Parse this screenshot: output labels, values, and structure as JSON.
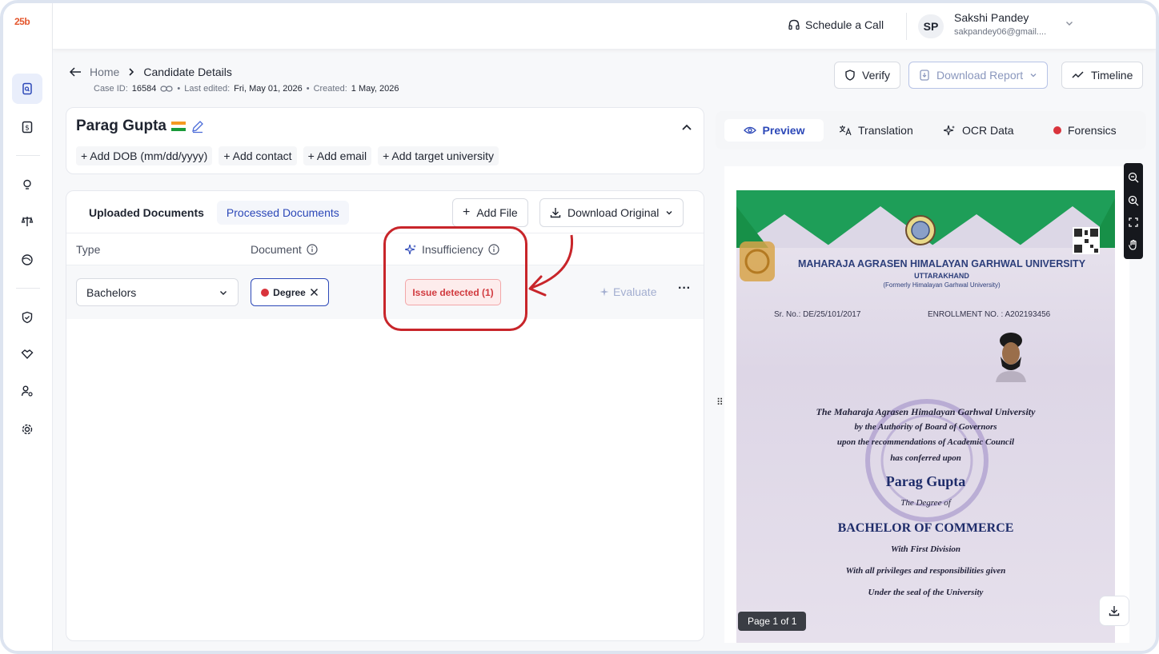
{
  "app": {
    "logo_text": "25b"
  },
  "topbar": {
    "schedule_label": "Schedule a Call",
    "user": {
      "initials": "SP",
      "name": "Sakshi Pandey",
      "email": "sakpandey06@gmail...."
    }
  },
  "breadcrumb": {
    "home": "Home",
    "current": "Candidate Details"
  },
  "meta": {
    "case_label": "Case ID:",
    "case_id": "16584",
    "edited_label": "Last edited:",
    "edited": "Fri, May 01, 2026",
    "created_label": "Created:",
    "created": "1 May, 2026",
    "separator": "•"
  },
  "actions": {
    "verify": "Verify",
    "download_report": "Download Report",
    "timeline": "Timeline"
  },
  "candidate": {
    "name": "Parag Gupta",
    "add_links": [
      "+ Add DOB (mm/dd/yyyy)",
      "+ Add contact",
      "+ Add email",
      "+ Add target university"
    ]
  },
  "documents": {
    "tabs": [
      "Uploaded Documents",
      "Processed Documents"
    ],
    "add_file": "Add File",
    "download_original": "Download Original",
    "columns": [
      "Type",
      "Document",
      "Insufficiency"
    ],
    "row": {
      "type": "Bachelors",
      "document": "Degree",
      "issue": "Issue detected (1)",
      "evaluate": "Evaluate",
      "more": "···"
    }
  },
  "preview": {
    "tabs": [
      "Preview",
      "Translation",
      "OCR Data",
      "Forensics"
    ],
    "page_indicator": "Page 1 of 1"
  },
  "certificate": {
    "university": "MAHARAJA AGRASEN HIMALAYAN GARHWAL UNIVERSITY",
    "state": "UTTARAKHAND",
    "formerly": "(Formerly Himalayan Garhwal University)",
    "serial": "Sr. No.: DE/25/101/2017",
    "enrollment": "ENROLLMENT NO. : A202193456",
    "lines": [
      "The Maharaja Agrasen Himalayan Garhwal University",
      "by the Authority of Board of Governors",
      "upon the recommendations of Academic Council",
      "has conferred upon"
    ],
    "recipient": "Parag Gupta",
    "degree_of": "The Degree of",
    "degree": "BACHELOR OF COMMERCE",
    "division": "With First Division",
    "privileges": "With all privileges and responsibilities given",
    "seal": "Under the seal of the University"
  },
  "colors": {
    "accent": "#2c48b8",
    "danger": "#d13a3f",
    "highlight": "#c8252a"
  }
}
